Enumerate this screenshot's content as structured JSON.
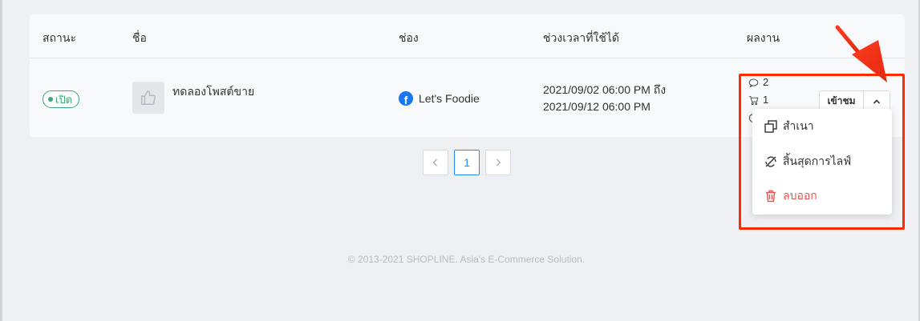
{
  "table": {
    "headers": {
      "status": "สถานะ",
      "name": "ชื่อ",
      "channel": "ช่อง",
      "period": "ช่วงเวลาที่ใช้ได้",
      "performance": "ผลงาน"
    },
    "row": {
      "status_badge": "เปิด",
      "post_name": "ทดลองโพสต์ขาย",
      "channel_name": "Let's Foodie",
      "period_line1": "2021/09/02 06:00 PM ถึง",
      "period_line2": "2021/09/12 06:00 PM",
      "comments_count": "2",
      "orders_count": "1",
      "view_label": "เข้าชม"
    }
  },
  "dropdown_menu": {
    "items": [
      {
        "label": "สำเนา",
        "icon": "copy-icon"
      },
      {
        "label": "สิ้นสุดการไลฟ์",
        "icon": "end-live-icon"
      },
      {
        "label": "ลบออก",
        "icon": "trash-icon"
      }
    ]
  },
  "pagination": {
    "current_page": "1",
    "prev_icon": "chevron-left-icon",
    "next_icon": "chevron-right-icon"
  },
  "footer": {
    "copyright": "© 2013-2021 SHOPLINE. Asia's E-Commerce Solution."
  },
  "colors": {
    "accent_green": "#3aa879",
    "link_blue": "#1f8cef",
    "danger_red": "#e0564e",
    "annotation_red": "#ff2a00",
    "facebook_blue": "#1877f2"
  }
}
